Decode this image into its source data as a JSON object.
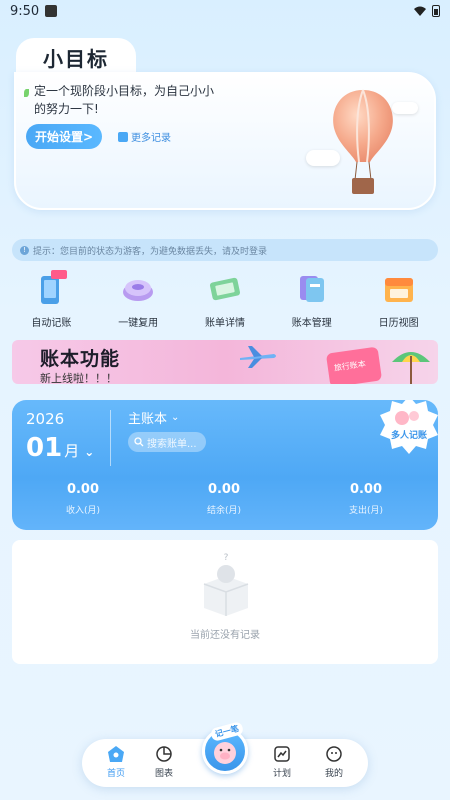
{
  "status_bar": {
    "time": "9:50"
  },
  "goal": {
    "title": "小目标",
    "description": "定一个现阶段小目标，为自己小小的努力一下!",
    "start_button": "开始设置>",
    "more_records": "更多记录"
  },
  "notice": {
    "text": "提示：您目前的状态为游客，为避免数据丢失，请及时登录"
  },
  "features": [
    {
      "label": "自动记账",
      "icon": "phone-new-icon"
    },
    {
      "label": "一键复用",
      "icon": "button-icon"
    },
    {
      "label": "账单详情",
      "icon": "bill-icon"
    },
    {
      "label": "账本管理",
      "icon": "ledger-icon"
    },
    {
      "label": "日历视图",
      "icon": "calendar-icon"
    }
  ],
  "banner": {
    "title": "账本功能",
    "subtitle": "新上线啦！！！",
    "tag": "旅行账本"
  },
  "account": {
    "year": "2026",
    "month": "01",
    "month_unit": "月",
    "name": "主账本",
    "search_placeholder": "搜索账单...",
    "badge": "多人记账",
    "stats": [
      {
        "value": "0.00",
        "label": "收入(月)"
      },
      {
        "value": "0.00",
        "label": "结余(月)"
      },
      {
        "value": "0.00",
        "label": "支出(月)"
      }
    ]
  },
  "empty_state": {
    "text": "当前还没有记录"
  },
  "tabbar": {
    "tabs": [
      {
        "label": "首页",
        "active": true
      },
      {
        "label": "图表",
        "active": false
      },
      {
        "label": "计划",
        "active": false
      },
      {
        "label": "我的",
        "active": false
      }
    ],
    "center_label": "记一笔"
  },
  "colors": {
    "accent": "#4aa8f5",
    "background": "#e6f4ff"
  }
}
